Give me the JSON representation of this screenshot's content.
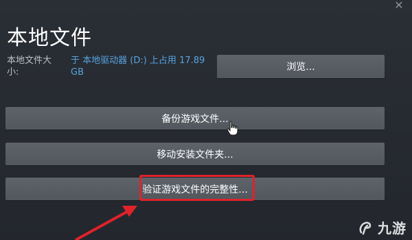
{
  "window": {
    "title": "本地文件",
    "close_glyph": "✕"
  },
  "local_files": {
    "size_label": "本地文件大小:",
    "size_value": "于 本地驱动器 (D:) 上占用 17.89 GB"
  },
  "buttons": {
    "browse": "浏览...",
    "backup": "备份游戏文件...",
    "move": "移动安装文件夹...",
    "verify": "验证游戏文件的完整性..."
  },
  "annotation": {
    "highlight_color": "#e0222a",
    "arrow_color": "#e0222a"
  },
  "watermark": {
    "text": "九游",
    "icon": "jiuyou-logo-icon"
  },
  "colors": {
    "background": "#262a31",
    "button": "#5a5f66",
    "link_blue": "#57a5e0"
  }
}
